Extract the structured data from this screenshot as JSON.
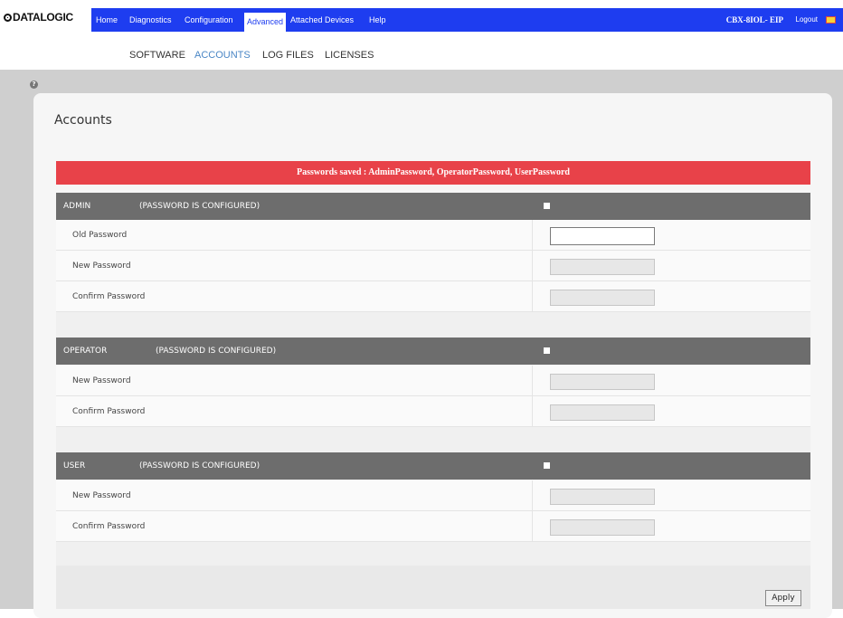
{
  "brand": {
    "logo_text": "DATALOGIC"
  },
  "nav": {
    "items": [
      {
        "label": "Home"
      },
      {
        "label": "Diagnostics"
      },
      {
        "label": "Configuration"
      },
      {
        "label": "Advanced"
      },
      {
        "label": "Attached Devices"
      },
      {
        "label": "Help"
      }
    ],
    "active": "Advanced",
    "device_name": "CBX-8IOL- EIP",
    "logout": "Logout"
  },
  "subnav": {
    "items": [
      {
        "label": "SOFTWARE"
      },
      {
        "label": "ACCOUNTS"
      },
      {
        "label": "LOG FILES"
      },
      {
        "label": "LICENSES"
      }
    ],
    "active": "ACCOUNTS"
  },
  "page": {
    "help_icon": "question-icon",
    "title": "Accounts",
    "banner": "Passwords saved : AdminPassword, OperatorPassword, UserPassword",
    "banner_color": "#e84249"
  },
  "sections": [
    {
      "name": "ADMIN",
      "status": "(PASSWORD IS CONFIGURED)",
      "fields": [
        {
          "label": "Old Password",
          "value": ""
        },
        {
          "label": "New Password",
          "value": ""
        },
        {
          "label": "Confirm Password",
          "value": ""
        }
      ]
    },
    {
      "name": "OPERATOR",
      "status": "(PASSWORD IS CONFIGURED)",
      "fields": [
        {
          "label": "New Password",
          "value": ""
        },
        {
          "label": "Confirm Password",
          "value": ""
        }
      ]
    },
    {
      "name": "USER",
      "status": "(PASSWORD IS CONFIGURED)",
      "fields": [
        {
          "label": "New Password",
          "value": ""
        },
        {
          "label": "Confirm Password",
          "value": ""
        }
      ]
    }
  ],
  "actions": {
    "apply_label": "Apply"
  },
  "colors": {
    "nav_blue": "#1e3df0",
    "section_header": "#6d6d6d",
    "accent_link": "#4a86c5"
  }
}
